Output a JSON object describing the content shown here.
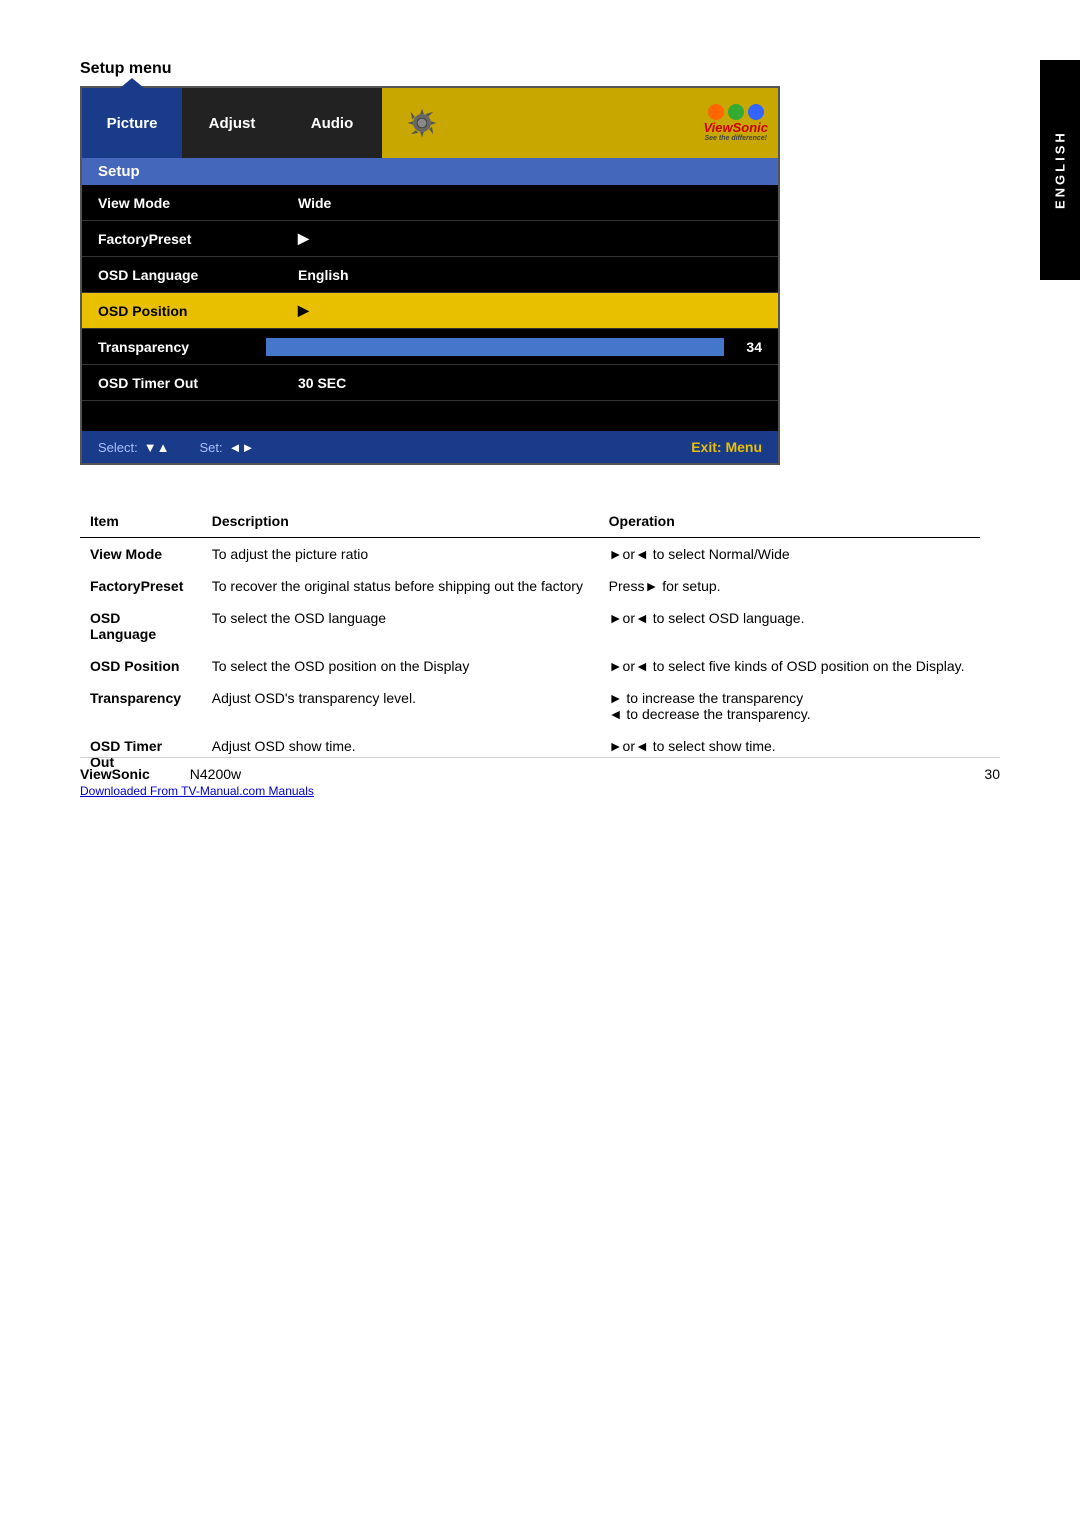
{
  "page": {
    "language_tab": "ENGLISH",
    "setup_menu_title": "Setup menu"
  },
  "tabs": [
    {
      "label": "Picture",
      "active": true,
      "type": "text"
    },
    {
      "label": "Adjust",
      "active": false,
      "type": "text"
    },
    {
      "label": "Audio",
      "active": false,
      "type": "text"
    },
    {
      "label": "⚙",
      "active": false,
      "type": "gear"
    },
    {
      "label": "ViewSonic",
      "active": false,
      "type": "logo"
    }
  ],
  "menu": {
    "section": "Setup",
    "rows": [
      {
        "label": "View Mode",
        "value": "Wide",
        "highlighted": false,
        "type": "value"
      },
      {
        "label": "FactoryPreset",
        "value": "▶",
        "highlighted": false,
        "type": "arrow"
      },
      {
        "label": "OSD Language",
        "value": "English",
        "highlighted": false,
        "type": "value"
      },
      {
        "label": "OSD Position",
        "value": "▶",
        "highlighted": true,
        "type": "arrow"
      },
      {
        "label": "Transparency",
        "value": "34",
        "highlighted": false,
        "type": "slider"
      },
      {
        "label": "OSD Timer Out",
        "value": "30 SEC",
        "highlighted": false,
        "type": "value"
      }
    ]
  },
  "bottom_bar": {
    "select_label": "Select:",
    "select_arrows": "▼▲",
    "set_label": "Set:",
    "set_arrows": "◄►",
    "exit_label": "Exit: Menu"
  },
  "table": {
    "headers": [
      "Item",
      "Description",
      "Operation"
    ],
    "rows": [
      {
        "item": "View Mode",
        "desc": "To adjust the picture ratio",
        "op": "►or◄ to select Normal/Wide"
      },
      {
        "item": "FactoryPreset",
        "desc": "To recover the original status before shipping out the factory",
        "op": "Press► for setup."
      },
      {
        "item": "OSD\nLanguage",
        "desc": "To select the OSD language",
        "op": "►or◄ to select OSD language."
      },
      {
        "item": "OSD Position",
        "desc": "To select the OSD position on the Display",
        "op": "►or◄ to select five kinds of OSD position on the Display."
      },
      {
        "item": "Transparency",
        "desc": "Adjust OSD's transparency level.",
        "op": "► to increase the transparency\n◄ to decrease the transparency."
      },
      {
        "item": "OSD Timer\nOut",
        "desc": "Adjust OSD show time.",
        "op": "►or◄ to select show time."
      }
    ]
  },
  "footer": {
    "brand": "ViewSonic",
    "model": "N4200w",
    "page": "30",
    "link": "Downloaded From TV-Manual.com Manuals"
  }
}
